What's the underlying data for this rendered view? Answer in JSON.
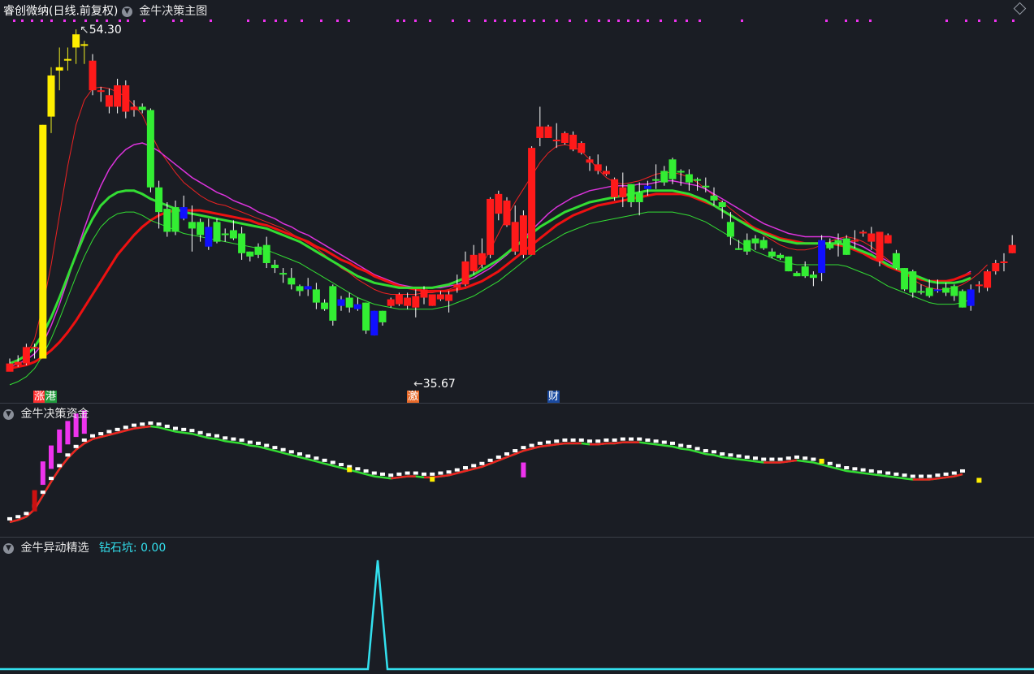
{
  "panels": {
    "main": {
      "title": "睿创微纳(日线.前复权)",
      "indicator": "金牛决策主图",
      "high_label": "54.30",
      "low_label": "35.67",
      "tags": [
        "涨",
        "港",
        "激",
        "财"
      ]
    },
    "fund": {
      "indicator": "金牛决策资金"
    },
    "signal": {
      "indicator": "金牛异动精选",
      "value_label": "钻石坑: 0.00"
    }
  },
  "colors": {
    "up": "#ff1a1a",
    "down": "#33ee33",
    "limit_up": "#ffee00",
    "flat_blue": "#1010ff",
    "magenta": "#ee33ee",
    "cyan": "#33e0ee",
    "background": "#1a1d24"
  },
  "chart_data": {
    "type": "candlestick",
    "price_range": [
      35.67,
      54.3
    ],
    "candles": [
      [
        33.5,
        34.0,
        33.8,
        34.3,
        "r"
      ],
      [
        33.9,
        34.1,
        33.8,
        34.5,
        "r"
      ],
      [
        34.0,
        35.0,
        33.9,
        35.2,
        "r"
      ],
      [
        35.0,
        35.0,
        34.3,
        35.2,
        "r"
      ],
      [
        34.3,
        48.5,
        34.3,
        48.5,
        "y"
      ],
      [
        49.0,
        51.5,
        48.0,
        52.0,
        "y"
      ],
      [
        51.8,
        52.0,
        50.6,
        53.2,
        "y"
      ],
      [
        52.5,
        52.5,
        51.8,
        53.2,
        "y"
      ],
      [
        53.2,
        54.0,
        52.2,
        54.3,
        "y"
      ],
      [
        53.4,
        53.4,
        52.2,
        53.6,
        "y"
      ],
      [
        52.4,
        50.6,
        50.3,
        52.8,
        "r"
      ],
      [
        50.6,
        50.5,
        49.9,
        50.8,
        "r"
      ],
      [
        50.3,
        49.6,
        49.2,
        50.7,
        "r"
      ],
      [
        49.6,
        50.9,
        49.2,
        51.3,
        "r"
      ],
      [
        50.9,
        49.3,
        48.9,
        51.2,
        "r"
      ],
      [
        49.4,
        49.6,
        49.0,
        50.0,
        "r"
      ],
      [
        49.6,
        49.4,
        49.2,
        49.8,
        "g"
      ],
      [
        49.4,
        44.7,
        44.4,
        49.5,
        "g"
      ],
      [
        44.7,
        43.2,
        42.2,
        45.1,
        "g"
      ],
      [
        43.4,
        42.0,
        41.7,
        43.8,
        "g"
      ],
      [
        42.0,
        43.5,
        41.8,
        43.9,
        "g"
      ],
      [
        43.5,
        42.8,
        42.7,
        44.2,
        "b"
      ],
      [
        42.6,
        42.2,
        40.8,
        43.6,
        "g"
      ],
      [
        42.6,
        41.8,
        41.4,
        42.8,
        "g"
      ],
      [
        42.3,
        41.1,
        40.9,
        42.8,
        "b"
      ],
      [
        41.4,
        42.6,
        41.3,
        42.8,
        "g"
      ],
      [
        41.9,
        41.8,
        41.4,
        42.2,
        "g"
      ],
      [
        42.1,
        41.6,
        41.5,
        42.7,
        "g"
      ],
      [
        41.9,
        40.7,
        40.3,
        42.3,
        "g"
      ],
      [
        40.8,
        40.5,
        40.2,
        40.8,
        "g"
      ],
      [
        40.6,
        41.1,
        40.4,
        41.3,
        "g"
      ],
      [
        41.2,
        40.1,
        39.8,
        41.7,
        "g"
      ],
      [
        40.0,
        39.8,
        39.5,
        40.3,
        "g"
      ],
      [
        39.5,
        39.5,
        38.9,
        39.8,
        "g"
      ],
      [
        39.2,
        38.8,
        38.5,
        39.8,
        "g"
      ],
      [
        38.7,
        38.4,
        38.1,
        38.8,
        "g"
      ],
      [
        38.7,
        38.5,
        38.1,
        39.2,
        "b"
      ],
      [
        38.5,
        37.7,
        37.3,
        38.9,
        "g"
      ],
      [
        37.7,
        37.3,
        37.2,
        37.9,
        "g"
      ],
      [
        38.7,
        36.6,
        36.3,
        38.8,
        "g"
      ],
      [
        37.9,
        37.5,
        37.2,
        38.1,
        "b"
      ],
      [
        38.0,
        37.4,
        37.1,
        38.3,
        "g"
      ],
      [
        37.6,
        37.3,
        37.2,
        38.0,
        "b"
      ],
      [
        37.7,
        36.0,
        35.8,
        37.7,
        "g"
      ],
      [
        37.2,
        35.7,
        35.7,
        37.2,
        "b"
      ],
      [
        37.2,
        36.5,
        36.3,
        37.2,
        "g"
      ],
      [
        37.9,
        37.5,
        37.4,
        38.0,
        "r"
      ],
      [
        38.2,
        37.6,
        37.5,
        38.3,
        "r"
      ],
      [
        37.5,
        38.0,
        37.3,
        38.3,
        "r"
      ],
      [
        37.4,
        38.1,
        36.8,
        38.5,
        "r"
      ],
      [
        38.5,
        38.0,
        37.6,
        38.7,
        "r"
      ],
      [
        38.2,
        37.5,
        37.5,
        38.2,
        "r"
      ],
      [
        38.2,
        37.9,
        37.8,
        38.4,
        "r"
      ],
      [
        38.2,
        37.8,
        37.1,
        38.4,
        "r"
      ],
      [
        38.6,
        38.8,
        38.3,
        39.4,
        "r"
      ],
      [
        40.2,
        38.8,
        38.7,
        40.8,
        "r"
      ],
      [
        40.6,
        39.6,
        39.4,
        41.2,
        "r"
      ],
      [
        40.7,
        40.0,
        39.8,
        41.6,
        "r"
      ],
      [
        44.0,
        40.6,
        40.4,
        44.1,
        "r"
      ],
      [
        44.3,
        43.1,
        42.7,
        44.5,
        "r"
      ],
      [
        43.9,
        42.4,
        42.3,
        44.1,
        "r"
      ],
      [
        42.6,
        40.8,
        40.6,
        43.6,
        "r"
      ],
      [
        43.0,
        40.6,
        40.4,
        43.3,
        "r"
      ],
      [
        47.1,
        40.6,
        40.6,
        47.2,
        "r"
      ],
      [
        48.4,
        47.7,
        47.2,
        49.6,
        "r"
      ],
      [
        48.4,
        47.7,
        47.7,
        48.5,
        "r"
      ],
      [
        47.6,
        47.6,
        47.1,
        48.6,
        "r"
      ],
      [
        48.0,
        47.4,
        47.3,
        48.1,
        "r"
      ],
      [
        47.9,
        47.0,
        46.9,
        48.1,
        "r"
      ],
      [
        47.4,
        46.8,
        46.7,
        47.5,
        "r"
      ],
      [
        46.4,
        46.2,
        45.7,
        46.6,
        "r"
      ],
      [
        46.1,
        45.7,
        45.5,
        46.7,
        "r"
      ],
      [
        45.7,
        45.5,
        45.4,
        46.0,
        "r"
      ],
      [
        45.2,
        44.1,
        43.9,
        45.3,
        "r"
      ],
      [
        44.7,
        44.1,
        43.5,
        45.6,
        "r"
      ],
      [
        43.8,
        44.9,
        43.5,
        44.9,
        "g"
      ],
      [
        44.4,
        43.8,
        43.0,
        45.0,
        "g"
      ],
      [
        44.6,
        44.8,
        44.2,
        45.1,
        "b"
      ],
      [
        45.2,
        45.2,
        44.6,
        46.1,
        "g"
      ],
      [
        45.0,
        45.7,
        44.8,
        46.0,
        "g"
      ],
      [
        46.4,
        45.2,
        44.9,
        46.5,
        "g"
      ],
      [
        45.7,
        45.6,
        44.8,
        45.8,
        "g"
      ],
      [
        45.5,
        45.0,
        44.5,
        45.8,
        "g"
      ],
      [
        45.2,
        45.1,
        44.5,
        45.3,
        "g"
      ],
      [
        44.8,
        44.7,
        44.4,
        45.3,
        "g"
      ],
      [
        44.2,
        43.9,
        43.6,
        44.7,
        "g"
      ],
      [
        43.8,
        43.5,
        42.8,
        43.9,
        "g"
      ],
      [
        42.6,
        41.7,
        41.2,
        43.2,
        "g"
      ],
      [
        41.0,
        40.9,
        40.9,
        41.5,
        "g"
      ],
      [
        41.5,
        40.8,
        40.6,
        41.9,
        "g"
      ],
      [
        41.6,
        41.3,
        40.9,
        41.8,
        "g"
      ],
      [
        41.5,
        41.0,
        40.9,
        41.7,
        "g"
      ],
      [
        40.8,
        40.5,
        40.4,
        41.0,
        "g"
      ],
      [
        40.6,
        40.4,
        40.3,
        40.7,
        "g"
      ],
      [
        40.5,
        39.6,
        39.6,
        40.5,
        "g"
      ],
      [
        39.5,
        39.3,
        39.3,
        39.6,
        "g"
      ],
      [
        39.9,
        39.3,
        39.2,
        40.2,
        "g"
      ],
      [
        39.4,
        39.2,
        38.7,
        39.6,
        "g"
      ],
      [
        41.5,
        39.5,
        39.0,
        41.8,
        "b"
      ],
      [
        41.3,
        41.0,
        40.9,
        41.6,
        "g"
      ],
      [
        41.5,
        41.3,
        40.5,
        41.9,
        "g"
      ],
      [
        41.6,
        40.6,
        40.6,
        41.8,
        "g"
      ],
      [
        41.5,
        41.5,
        41.0,
        42.1,
        "r"
      ],
      [
        42.0,
        41.9,
        41.7,
        42.1,
        "r"
      ],
      [
        41.9,
        41.4,
        40.9,
        42.3,
        "r"
      ],
      [
        42.0,
        40.2,
        39.9,
        42.0,
        "r"
      ],
      [
        41.8,
        41.3,
        41.3,
        41.9,
        "r"
      ],
      [
        40.7,
        39.8,
        39.7,
        40.9,
        "g"
      ],
      [
        39.8,
        38.5,
        38.4,
        39.8,
        "g"
      ],
      [
        39.6,
        38.3,
        38.0,
        39.7,
        "g"
      ],
      [
        38.4,
        38.3,
        38.2,
        38.8,
        "g"
      ],
      [
        38.6,
        38.1,
        38.0,
        39.1,
        "g"
      ],
      [
        38.5,
        38.4,
        38.3,
        39.1,
        "b"
      ],
      [
        38.6,
        38.3,
        38.1,
        38.9,
        "g"
      ],
      [
        38.7,
        38.1,
        37.8,
        38.8,
        "g"
      ],
      [
        38.4,
        37.4,
        37.4,
        38.5,
        "g"
      ],
      [
        38.5,
        37.5,
        37.2,
        38.8,
        "b"
      ],
      [
        38.7,
        38.8,
        38.3,
        39.0,
        "r"
      ],
      [
        39.6,
        38.6,
        38.4,
        39.7,
        "r"
      ],
      [
        40.1,
        39.6,
        39.4,
        40.3,
        "r"
      ],
      [
        40.1,
        40.2,
        39.6,
        40.7,
        "r"
      ],
      [
        41.2,
        40.7,
        40.7,
        41.8,
        "r"
      ]
    ],
    "moving_averages": {
      "ma_fast_red": [
        34.0,
        34.2,
        34.5,
        35.5,
        37.5,
        40.0,
        43.0,
        46.0,
        48.5,
        50.0,
        50.7,
        50.8,
        50.7,
        50.5,
        50.2,
        49.7,
        49.1,
        48.0,
        47.0,
        46.3,
        45.6,
        45.0,
        44.6,
        44.2,
        43.9,
        43.7,
        43.6,
        43.4,
        43.2,
        43.0,
        42.8,
        42.6,
        42.4,
        42.2,
        41.9,
        41.6,
        41.3,
        41.0,
        40.6,
        40.2,
        39.8,
        39.5,
        39.1,
        38.8,
        38.5,
        38.3,
        38.2,
        38.2,
        38.2,
        38.2,
        38.3,
        38.3,
        38.4,
        38.5,
        38.7,
        39.0,
        39.4,
        40.0,
        40.9,
        41.9,
        42.9,
        43.8,
        44.6,
        45.4,
        46.2,
        46.8,
        47.2,
        47.3,
        47.2,
        46.9,
        46.4,
        45.8,
        45.3,
        45.0,
        44.9,
        45.0,
        45.1,
        45.3,
        45.5,
        45.6,
        45.6,
        45.5,
        45.3,
        45.0,
        44.6,
        44.2,
        43.8,
        43.4,
        43.0,
        42.6,
        42.2,
        41.8,
        41.5,
        41.2,
        41.0,
        40.9,
        40.9,
        41.0,
        41.2,
        41.4,
        41.6,
        41.7,
        41.6,
        41.4,
        41.1,
        40.7,
        40.3,
        39.9,
        39.5,
        39.1,
        38.8,
        38.6,
        38.5,
        38.5,
        38.6,
        38.8,
        39.1,
        39.5,
        40.0
      ],
      "ma_mid_magenta": [
        33.8,
        34.0,
        34.2,
        34.6,
        35.2,
        36.3,
        37.6,
        39.1,
        40.7,
        42.2,
        43.6,
        44.8,
        45.8,
        46.5,
        47.0,
        47.3,
        47.4,
        47.2,
        46.9,
        46.5,
        46.1,
        45.7,
        45.3,
        45.0,
        44.7,
        44.4,
        44.2,
        43.9,
        43.7,
        43.5,
        43.2,
        43.0,
        42.8,
        42.5,
        42.3,
        42.0,
        41.8,
        41.5,
        41.2,
        40.9,
        40.6,
        40.3,
        40.0,
        39.7,
        39.4,
        39.2,
        39.0,
        38.8,
        38.7,
        38.6,
        38.6,
        38.6,
        38.6,
        38.7,
        38.8,
        39.0,
        39.2,
        39.5,
        39.8,
        40.2,
        40.6,
        41.1,
        41.6,
        42.1,
        42.6,
        43.1,
        43.5,
        43.8,
        44.1,
        44.3,
        44.5,
        44.6,
        44.7,
        44.8,
        44.8,
        44.8,
        44.9,
        44.9,
        45.0,
        45.1,
        45.1,
        45.0,
        44.9,
        44.8,
        44.6,
        44.3,
        44.0,
        43.7,
        43.4,
        43.1,
        42.8,
        42.5,
        42.3,
        42.1,
        41.9,
        41.8,
        41.7,
        41.7,
        41.7,
        41.7,
        41.6,
        41.5,
        41.3,
        41.1,
        40.8,
        40.5,
        40.2,
        39.9,
        39.6,
        39.3,
        39.1,
        39.0,
        38.9,
        39.0,
        39.1,
        39.3,
        39.6
      ],
      "ma_slow_red": [
        33.7,
        33.8,
        33.9,
        34.1,
        34.4,
        34.8,
        35.3,
        35.9,
        36.6,
        37.4,
        38.2,
        39.0,
        39.8,
        40.6,
        41.2,
        41.8,
        42.3,
        42.7,
        43.0,
        43.2,
        43.3,
        43.3,
        43.3,
        43.3,
        43.2,
        43.1,
        43.0,
        42.9,
        42.8,
        42.7,
        42.5,
        42.4,
        42.2,
        42.0,
        41.8,
        41.6,
        41.4,
        41.1,
        40.9,
        40.6,
        40.3,
        40.1,
        39.8,
        39.6,
        39.3,
        39.1,
        38.9,
        38.7,
        38.6,
        38.5,
        38.4,
        38.4,
        38.4,
        38.4,
        38.5,
        38.6,
        38.8,
        39.0,
        39.3,
        39.6,
        40.0,
        40.4,
        40.8,
        41.2,
        41.6,
        42.0,
        42.4,
        42.7,
        43.0,
        43.2,
        43.4,
        43.6,
        43.7,
        43.8,
        43.9,
        44.0,
        44.1,
        44.2,
        44.3,
        44.3,
        44.3,
        44.3,
        44.2,
        44.0,
        43.8,
        43.6,
        43.3,
        43.0,
        42.7,
        42.5,
        42.2,
        42.0,
        41.8,
        41.6,
        41.5,
        41.4,
        41.3,
        41.3,
        41.3,
        41.3,
        41.2,
        41.1,
        40.9,
        40.7,
        40.4,
        40.2,
        39.9,
        39.7,
        39.5,
        39.3,
        39.1,
        39.0,
        39.0,
        39.0,
        39.1,
        39.3,
        39.5
      ],
      "band_upper_green": [
        34.0,
        34.2,
        34.5,
        35.0,
        35.8,
        36.8,
        38.0,
        39.3,
        40.6,
        41.8,
        42.8,
        43.6,
        44.1,
        44.4,
        44.5,
        44.5,
        44.3,
        44.0,
        43.8,
        43.6,
        43.4,
        43.2,
        43.1,
        43.0,
        42.9,
        42.8,
        42.7,
        42.6,
        42.5,
        42.4,
        42.3,
        42.2,
        42.0,
        41.8,
        41.6,
        41.4,
        41.1,
        40.8,
        40.5,
        40.2,
        39.9,
        39.6,
        39.3,
        39.1,
        38.9,
        38.8,
        38.7,
        38.6,
        38.6,
        38.6,
        38.6,
        38.6,
        38.7,
        38.8,
        39.0,
        39.2,
        39.4,
        39.7,
        40.0,
        40.3,
        40.7,
        41.1,
        41.5,
        41.9,
        42.3,
        42.6,
        42.9,
        43.2,
        43.4,
        43.6,
        43.8,
        43.9,
        44.0,
        44.1,
        44.2,
        44.3,
        44.4,
        44.5,
        44.5,
        44.5,
        44.5,
        44.4,
        44.3,
        44.1,
        43.9,
        43.6,
        43.3,
        43.0,
        42.7,
        42.4,
        42.1,
        41.9,
        41.7,
        41.5,
        41.4,
        41.3,
        41.3,
        41.3,
        41.3,
        41.3,
        41.3,
        41.2,
        41.0,
        40.8,
        40.6,
        40.3,
        40.0,
        39.8,
        39.6,
        39.4,
        39.2,
        39.0,
        38.9,
        38.9,
        38.9,
        39.0,
        39.2
      ]
    },
    "fund_flow": {
      "type": "line",
      "values": [
        0.1,
        0.12,
        0.15,
        0.22,
        0.35,
        0.48,
        0.6,
        0.7,
        0.78,
        0.84,
        0.88,
        0.9,
        0.92,
        0.94,
        0.96,
        0.98,
        0.99,
        1.0,
        0.99,
        0.97,
        0.95,
        0.94,
        0.93,
        0.91,
        0.89,
        0.88,
        0.86,
        0.85,
        0.84,
        0.82,
        0.81,
        0.79,
        0.77,
        0.75,
        0.73,
        0.71,
        0.69,
        0.67,
        0.65,
        0.63,
        0.61,
        0.59,
        0.57,
        0.55,
        0.53,
        0.52,
        0.51,
        0.52,
        0.53,
        0.53,
        0.52,
        0.52,
        0.53,
        0.54,
        0.56,
        0.58,
        0.6,
        0.62,
        0.65,
        0.68,
        0.71,
        0.74,
        0.77,
        0.79,
        0.81,
        0.82,
        0.83,
        0.84,
        0.84,
        0.84,
        0.83,
        0.83,
        0.84,
        0.84,
        0.85,
        0.85,
        0.85,
        0.84,
        0.83,
        0.82,
        0.81,
        0.79,
        0.78,
        0.76,
        0.74,
        0.73,
        0.71,
        0.7,
        0.69,
        0.68,
        0.67,
        0.66,
        0.66,
        0.66,
        0.67,
        0.68,
        0.67,
        0.66,
        0.64,
        0.62,
        0.6,
        0.58,
        0.57,
        0.56,
        0.55,
        0.54,
        0.53,
        0.52,
        0.51,
        0.5,
        0.5,
        0.5,
        0.51,
        0.52,
        0.53,
        0.55
      ]
    },
    "signal": {
      "type": "line",
      "name": "钻石坑",
      "spike_index": 45,
      "value": 0.0
    }
  }
}
